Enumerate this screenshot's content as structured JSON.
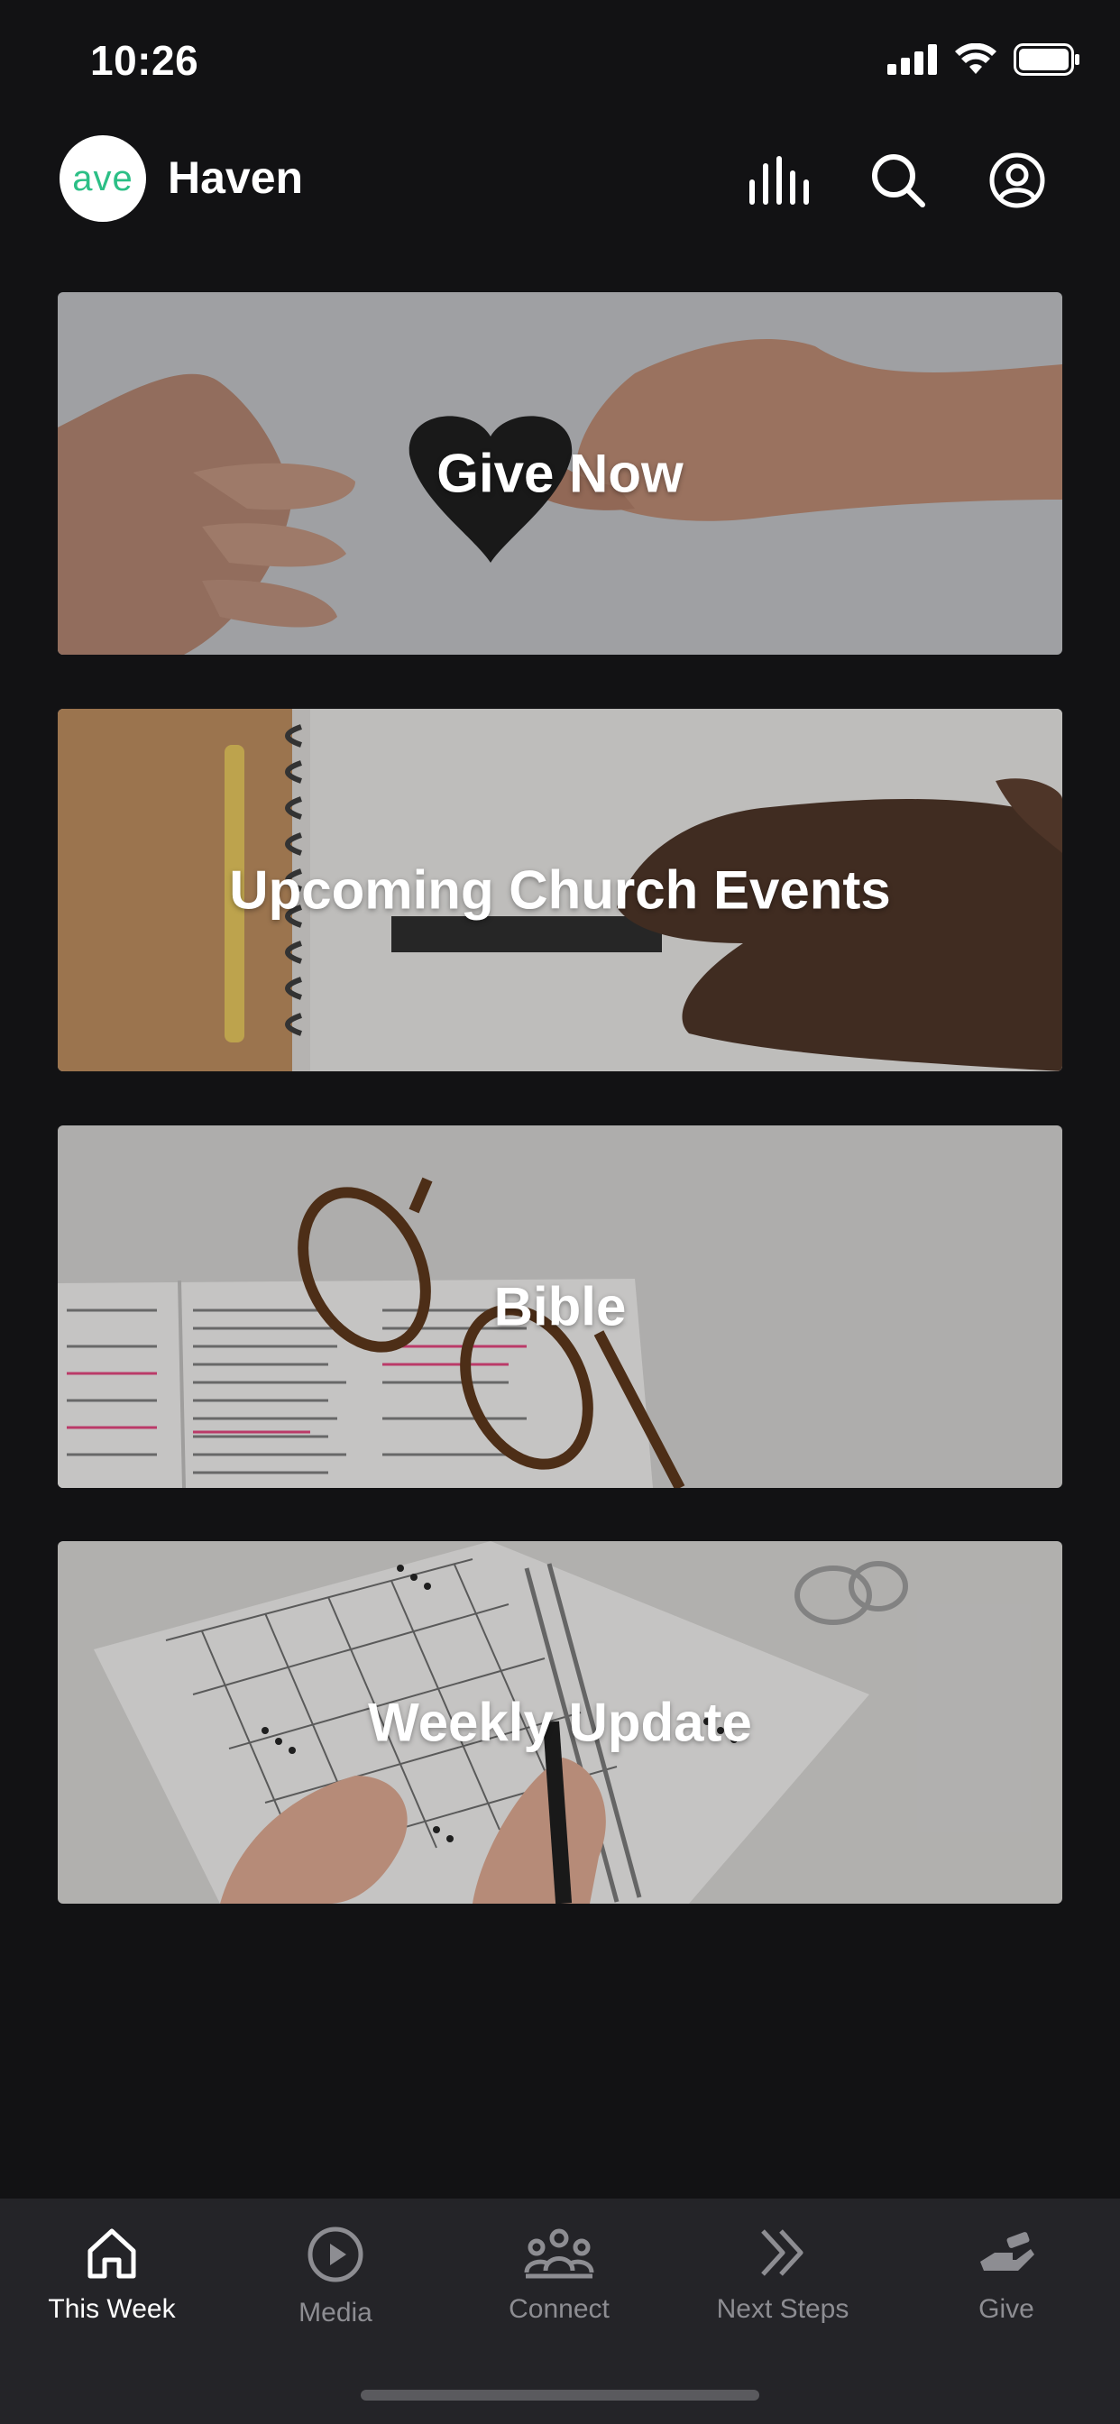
{
  "status_bar": {
    "time": "10:26"
  },
  "header": {
    "logo_text": "ave",
    "title": "Haven"
  },
  "cards": [
    {
      "label": "Give Now"
    },
    {
      "label": "Upcoming Church Events"
    },
    {
      "label": "Bible"
    },
    {
      "label": "Weekly Update"
    }
  ],
  "tabs": [
    {
      "label": "This Week",
      "icon": "home-icon",
      "active": true
    },
    {
      "label": "Media",
      "icon": "play-circle-icon",
      "active": false
    },
    {
      "label": "Connect",
      "icon": "group-icon",
      "active": false
    },
    {
      "label": "Next Steps",
      "icon": "double-chevron-right-icon",
      "active": false
    },
    {
      "label": "Give",
      "icon": "giving-hand-icon",
      "active": false
    }
  ],
  "colors": {
    "background": "#121214",
    "tabbar": "#242428",
    "brand": "#2cbf86",
    "inactive_tab": "#8d8d92"
  }
}
